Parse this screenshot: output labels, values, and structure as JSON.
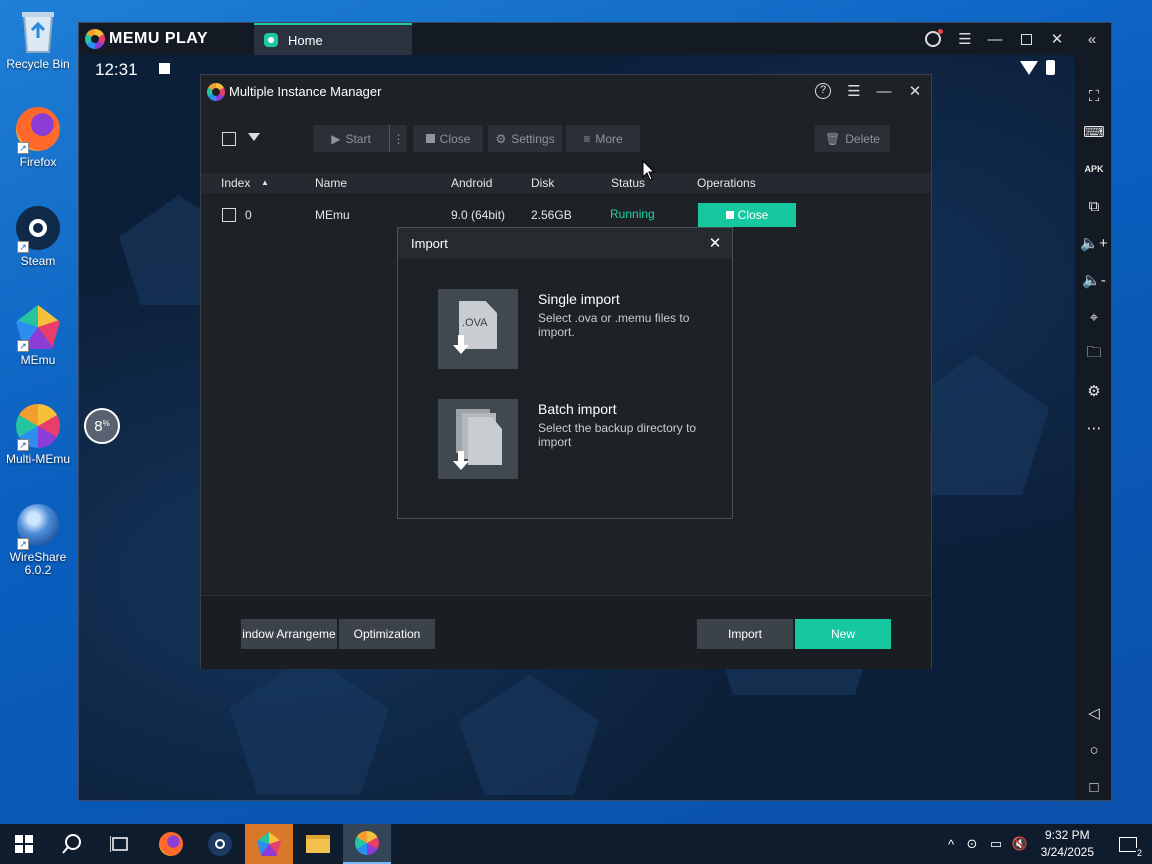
{
  "desktop": {
    "icons": [
      {
        "label": "Recycle Bin",
        "icon": "recycle-bin-icon"
      },
      {
        "label": "Firefox",
        "icon": "firefox-icon"
      },
      {
        "label": "Steam",
        "icon": "steam-icon"
      },
      {
        "label": "MEmu",
        "icon": "memu-icon"
      },
      {
        "label": "Multi-MEmu",
        "icon": "multi-memu-icon"
      },
      {
        "label": "WireShare\n6.0.2",
        "icon": "wireshare-icon"
      }
    ]
  },
  "emulator": {
    "brand": "MEMU PLAY",
    "tab_label": "Home",
    "clock": "12:31",
    "progress_label": "8",
    "progress_unit": "%"
  },
  "manager": {
    "title": "Multiple Instance Manager",
    "toolbar": {
      "start": "Start",
      "close": "Close",
      "settings": "Settings",
      "more": "More",
      "delete": "Delete"
    },
    "columns": [
      "Index",
      "Name",
      "Android",
      "Disk",
      "Status",
      "Operations"
    ],
    "rows": [
      {
        "index": "0",
        "name": "MEmu",
        "android": "9.0 (64bit)",
        "disk": "2.56GB",
        "status": "Running",
        "operation": "Close"
      }
    ],
    "footer": {
      "window_arrange": "indow Arrangeme",
      "optimization": "Optimization",
      "import": "Import",
      "new": "New"
    }
  },
  "import_dialog": {
    "title": "Import",
    "single": {
      "heading": "Single import",
      "description": "Select .ova or .memu files to import.",
      "badge": ".OVA"
    },
    "batch": {
      "heading": "Batch import",
      "description": "Select the backup directory to import"
    }
  },
  "taskbar": {
    "time": "9:32 PM",
    "date": "3/24/2025",
    "notification_count": "2"
  },
  "colors": {
    "accent": "#16c8a0",
    "running": "#1fd6a8",
    "desktop": "#0a5fbf",
    "panel": "#1e2226"
  }
}
